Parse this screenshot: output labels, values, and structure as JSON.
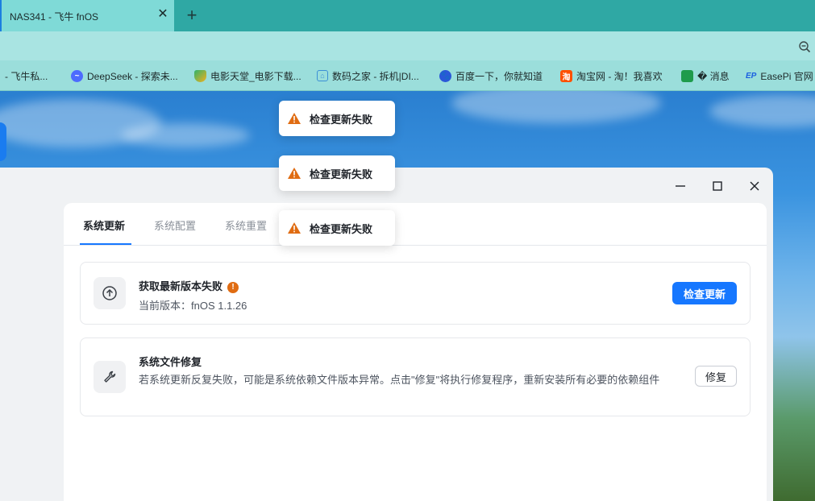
{
  "browser": {
    "active_tab_title": "NAS341 - 飞牛 fnOS",
    "tab_close_glyph": "✕",
    "new_tab_glyph": "+",
    "bookmarks": [
      {
        "label": "- 飞牛私...",
        "icon": "fnos-icon",
        "color": "#2a8bd8"
      },
      {
        "label": "DeepSeek - 探索未...",
        "icon": "deepseek-icon",
        "color": "#4d6bfe"
      },
      {
        "label": "电影天堂_电影下载...",
        "icon": "shield-icon",
        "color": "#2fb36a"
      },
      {
        "label": "数码之家 - 拆机|DI...",
        "icon": "home-icon",
        "color": "#3b8fd6"
      },
      {
        "label": "百度一下，你就知道",
        "icon": "baidu-paw-icon",
        "color": "#2a58d8"
      },
      {
        "label": "淘宝网 - 淘！我喜欢",
        "icon": "taobao-icon",
        "color": "#ff5000"
      },
      {
        "label": "� 消息",
        "icon": "green-cube-icon",
        "color": "#1e9b4c"
      },
      {
        "label": "EasePi 官网",
        "icon": "easepi-icon",
        "color": "#1b5fe0"
      }
    ]
  },
  "toasts": [
    {
      "text": "检查更新失败"
    },
    {
      "text": "检查更新失败"
    },
    {
      "text": "检查更新失败"
    }
  ],
  "window": {
    "tabs": [
      {
        "label": "系统更新",
        "active": true
      },
      {
        "label": "系统配置",
        "active": false
      },
      {
        "label": "系统重置",
        "active": false
      }
    ],
    "update_card": {
      "title": "获取最新版本失败",
      "status_badge": "!",
      "version_text": "当前版本：fnOS 1.1.26",
      "button_label": "检查更新"
    },
    "repair_card": {
      "title": "系统文件修复",
      "description": "若系统更新反复失败，可能是系统依赖文件版本异常。点击\"修复\"将执行修复程序，重新安装所有必要的依赖组件",
      "button_label": "修复"
    }
  },
  "colors": {
    "accent": "#1677ff",
    "warning": "#e06c12"
  }
}
